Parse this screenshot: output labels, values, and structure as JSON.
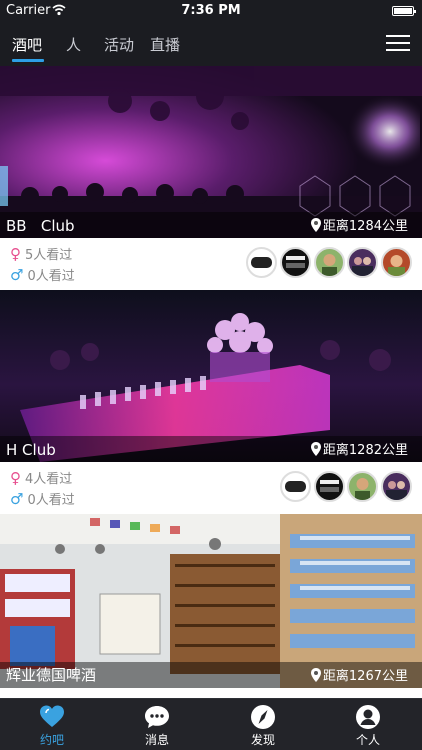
{
  "status_bar": {
    "carrier": "Carrier",
    "time": "7:36 PM"
  },
  "top_tabs": [
    {
      "label": "酒吧",
      "active": true
    },
    {
      "label": "人",
      "active": false
    },
    {
      "label": "活动",
      "active": false
    },
    {
      "label": "直播",
      "active": false
    }
  ],
  "venues": [
    {
      "name": "BB   Club",
      "distance": "距离1284公里",
      "female_views": "5人看过",
      "male_views": "0人看过"
    },
    {
      "name": "H Club",
      "distance": "距离1282公里",
      "female_views": "4人看过",
      "male_views": "0人看过"
    },
    {
      "name": "辉业德国啤酒",
      "distance": "距离1267公里"
    }
  ],
  "symbols": {
    "female": "♀",
    "male": "♂"
  },
  "bottom_tabs": [
    {
      "label": "约吧",
      "icon": "heart-icon",
      "active": true
    },
    {
      "label": "消息",
      "icon": "chat-bubble-icon",
      "active": false
    },
    {
      "label": "发现",
      "icon": "compass-icon",
      "active": false
    },
    {
      "label": "个人",
      "icon": "person-icon",
      "active": false
    }
  ],
  "colors": {
    "accent": "#2d9fe6",
    "female": "#e7508f",
    "male": "#3aa2e0",
    "background": "#1e1f24"
  }
}
